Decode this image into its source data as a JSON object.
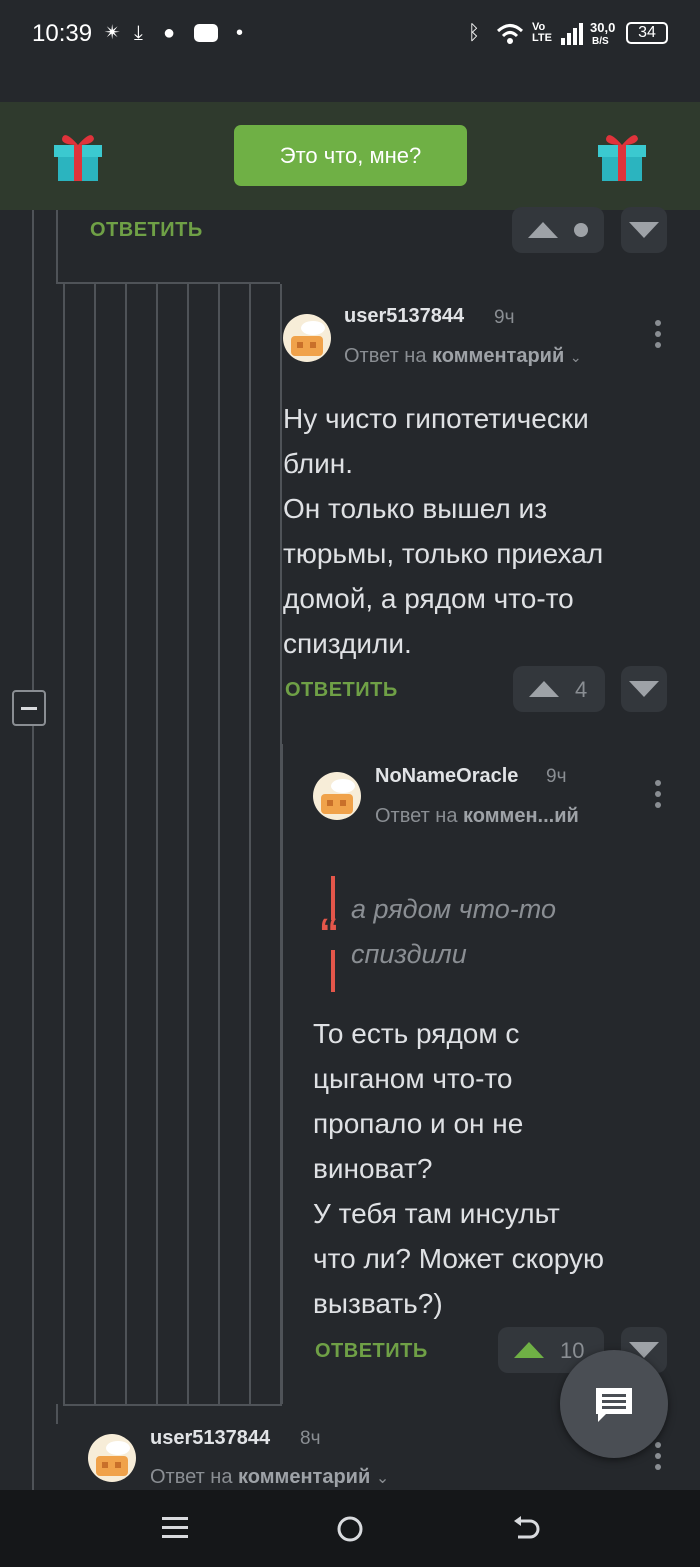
{
  "status_bar": {
    "time": "10:39",
    "network_label": "Vo LTE",
    "speed_top": "30,0",
    "speed_bottom": "B/S",
    "battery": "34"
  },
  "banner": {
    "button_label": "Это что, мне?"
  },
  "top_reply": {
    "answer_label": "ОТВЕТИТЬ"
  },
  "comments": [
    {
      "username": "user5137844",
      "time": "9ч",
      "reply_prefix": "Ответ на",
      "reply_target": "комментарий",
      "lines": [
        "Ну чисто гипотетически",
        "блин.",
        "Он только вышел из",
        "тюрьмы, только приехал",
        "домой, а рядом что-то",
        "спиздили."
      ],
      "answer_label": "ОТВЕТИТЬ",
      "rating": "4"
    },
    {
      "username": "NoNameOracle",
      "time": "9ч",
      "reply_prefix": "Ответ на",
      "reply_target": "коммен...ий",
      "quote_lines": [
        "а рядом что-то",
        "спиздили"
      ],
      "lines": [
        "То есть рядом с",
        "цыганом что-то",
        "пропало и он не",
        "виноват?",
        "У тебя там инсульт",
        "что ли? Может скорую",
        "вызвать?)"
      ],
      "answer_label": "ОТВЕТИТЬ",
      "rating": "10"
    },
    {
      "username": "user5137844",
      "time": "8ч",
      "reply_prefix": "Ответ на",
      "reply_target": "комментарий"
    }
  ],
  "colors": {
    "accent_green": "#6fb045",
    "background": "#25282c",
    "quote_mark": "#e4564a"
  },
  "icons": [
    "gift-icon",
    "upvote-icon",
    "downvote-icon",
    "more-icon",
    "chat-icon",
    "menu-icon",
    "home-icon",
    "back-icon"
  ]
}
